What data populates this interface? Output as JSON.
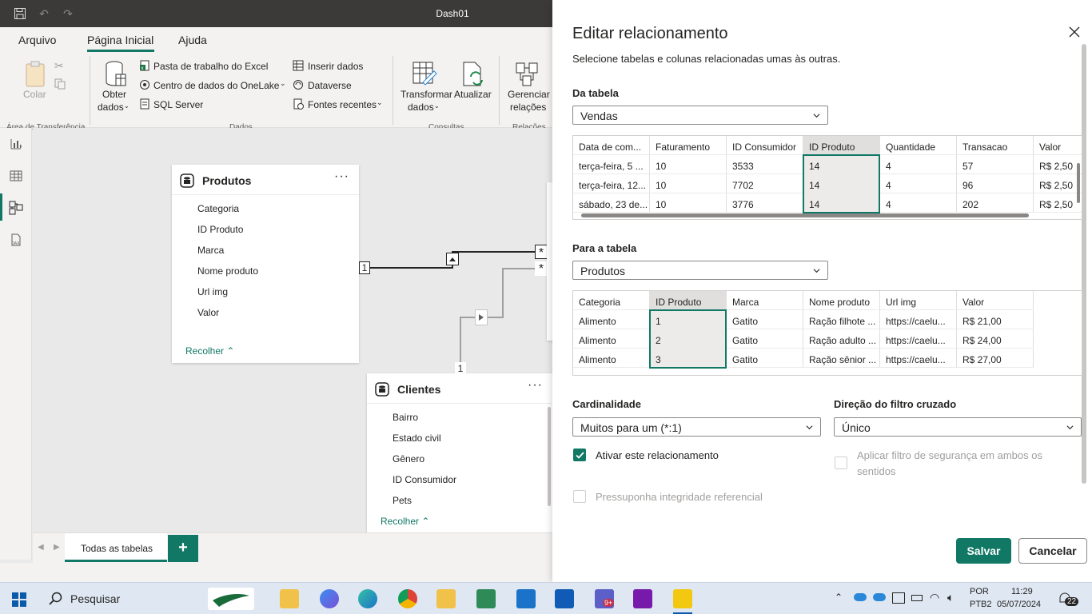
{
  "window": {
    "title": "Dash01"
  },
  "menu": {
    "items": [
      "Arquivo",
      "Página Inicial",
      "Ajuda"
    ],
    "active": "Página Inicial"
  },
  "ribbon": {
    "clipboard": {
      "paste": "Colar",
      "group": "Área de Transferência"
    },
    "data": {
      "get_data": [
        "Obter",
        "dados"
      ],
      "excel": "Pasta de trabalho do Excel",
      "onelake": "Centro de dados do OneLake",
      "sql": "SQL Server",
      "insert": "Inserir dados",
      "dataverse": "Dataverse",
      "recent": "Fontes recentes",
      "group": "Dados"
    },
    "queries": {
      "transform": [
        "Transformar",
        "dados"
      ],
      "refresh": "Atualizar",
      "group": "Consultas"
    },
    "relations": {
      "manage": [
        "Gerenciar",
        "relações"
      ],
      "group": "Relações"
    }
  },
  "canvas": {
    "produtos": {
      "title": "Produtos",
      "fields": [
        "Categoria",
        "ID Produto",
        "Marca",
        "Nome produto",
        "Url img",
        "Valor"
      ],
      "collapse": "Recolher"
    },
    "clientes": {
      "title": "Clientes",
      "fields": [
        "Bairro",
        "Estado civil",
        "Gênero",
        "ID Consumidor",
        "Pets"
      ],
      "collapse": "Recolher"
    },
    "rel_one_left": "1",
    "rel_one_bottom": "1",
    "rel_many_top": "*",
    "rel_many_bottom": "*"
  },
  "tabs": {
    "all_tables": "Todas as tabelas",
    "add": "+"
  },
  "dialog": {
    "title": "Editar relacionamento",
    "subtitle": "Selecione tabelas e colunas relacionadas umas às outras.",
    "from_label": "Da tabela",
    "from_value": "Vendas",
    "from_grid": {
      "headers": [
        "Data de com...",
        "Faturamento",
        "ID Consumidor",
        "ID Produto",
        "Quantidade",
        "Transacao",
        "Valor"
      ],
      "rows": [
        [
          "terça-feira, 5 ...",
          "10",
          "3533",
          "14",
          "4",
          "57",
          "R$ 2,50"
        ],
        [
          "terça-feira, 12...",
          "10",
          "7702",
          "14",
          "4",
          "96",
          "R$ 2,50"
        ],
        [
          "sábado, 23 de...",
          "10",
          "3776",
          "14",
          "4",
          "202",
          "R$ 2,50"
        ]
      ],
      "selected_column": 3
    },
    "to_label": "Para a tabela",
    "to_value": "Produtos",
    "to_grid": {
      "headers": [
        "Categoria",
        "ID Produto",
        "Marca",
        "Nome produto",
        "Url img",
        "Valor"
      ],
      "rows": [
        [
          "Alimento",
          "1",
          "Gatito",
          "Ração filhote ...",
          "https://caelu...",
          "R$ 21,00"
        ],
        [
          "Alimento",
          "2",
          "Gatito",
          "Ração adulto ...",
          "https://caelu...",
          "R$ 24,00"
        ],
        [
          "Alimento",
          "3",
          "Gatito",
          "Ração sênior ...",
          "https://caelu...",
          "R$ 27,00"
        ]
      ],
      "selected_column": 1
    },
    "cardinality_label": "Cardinalidade",
    "cardinality_value": "Muitos para um (*:1)",
    "direction_label": "Direção do filtro cruzado",
    "direction_value": "Único",
    "activate_label": "Ativar este relacionamento",
    "activate_checked": true,
    "security_label": [
      "Aplicar filtro de segurança em ambos os",
      "sentidos"
    ],
    "integrity_label": "Pressuponha integridade referencial",
    "save": "Salvar",
    "cancel": "Cancelar",
    "accent": "#117865"
  },
  "taskbar": {
    "search": "Pesquisar",
    "lang": [
      "POR",
      "PTB2"
    ],
    "time": "11:29",
    "date": "05/07/2024",
    "notifications": "22",
    "teams_badge": "9+"
  }
}
